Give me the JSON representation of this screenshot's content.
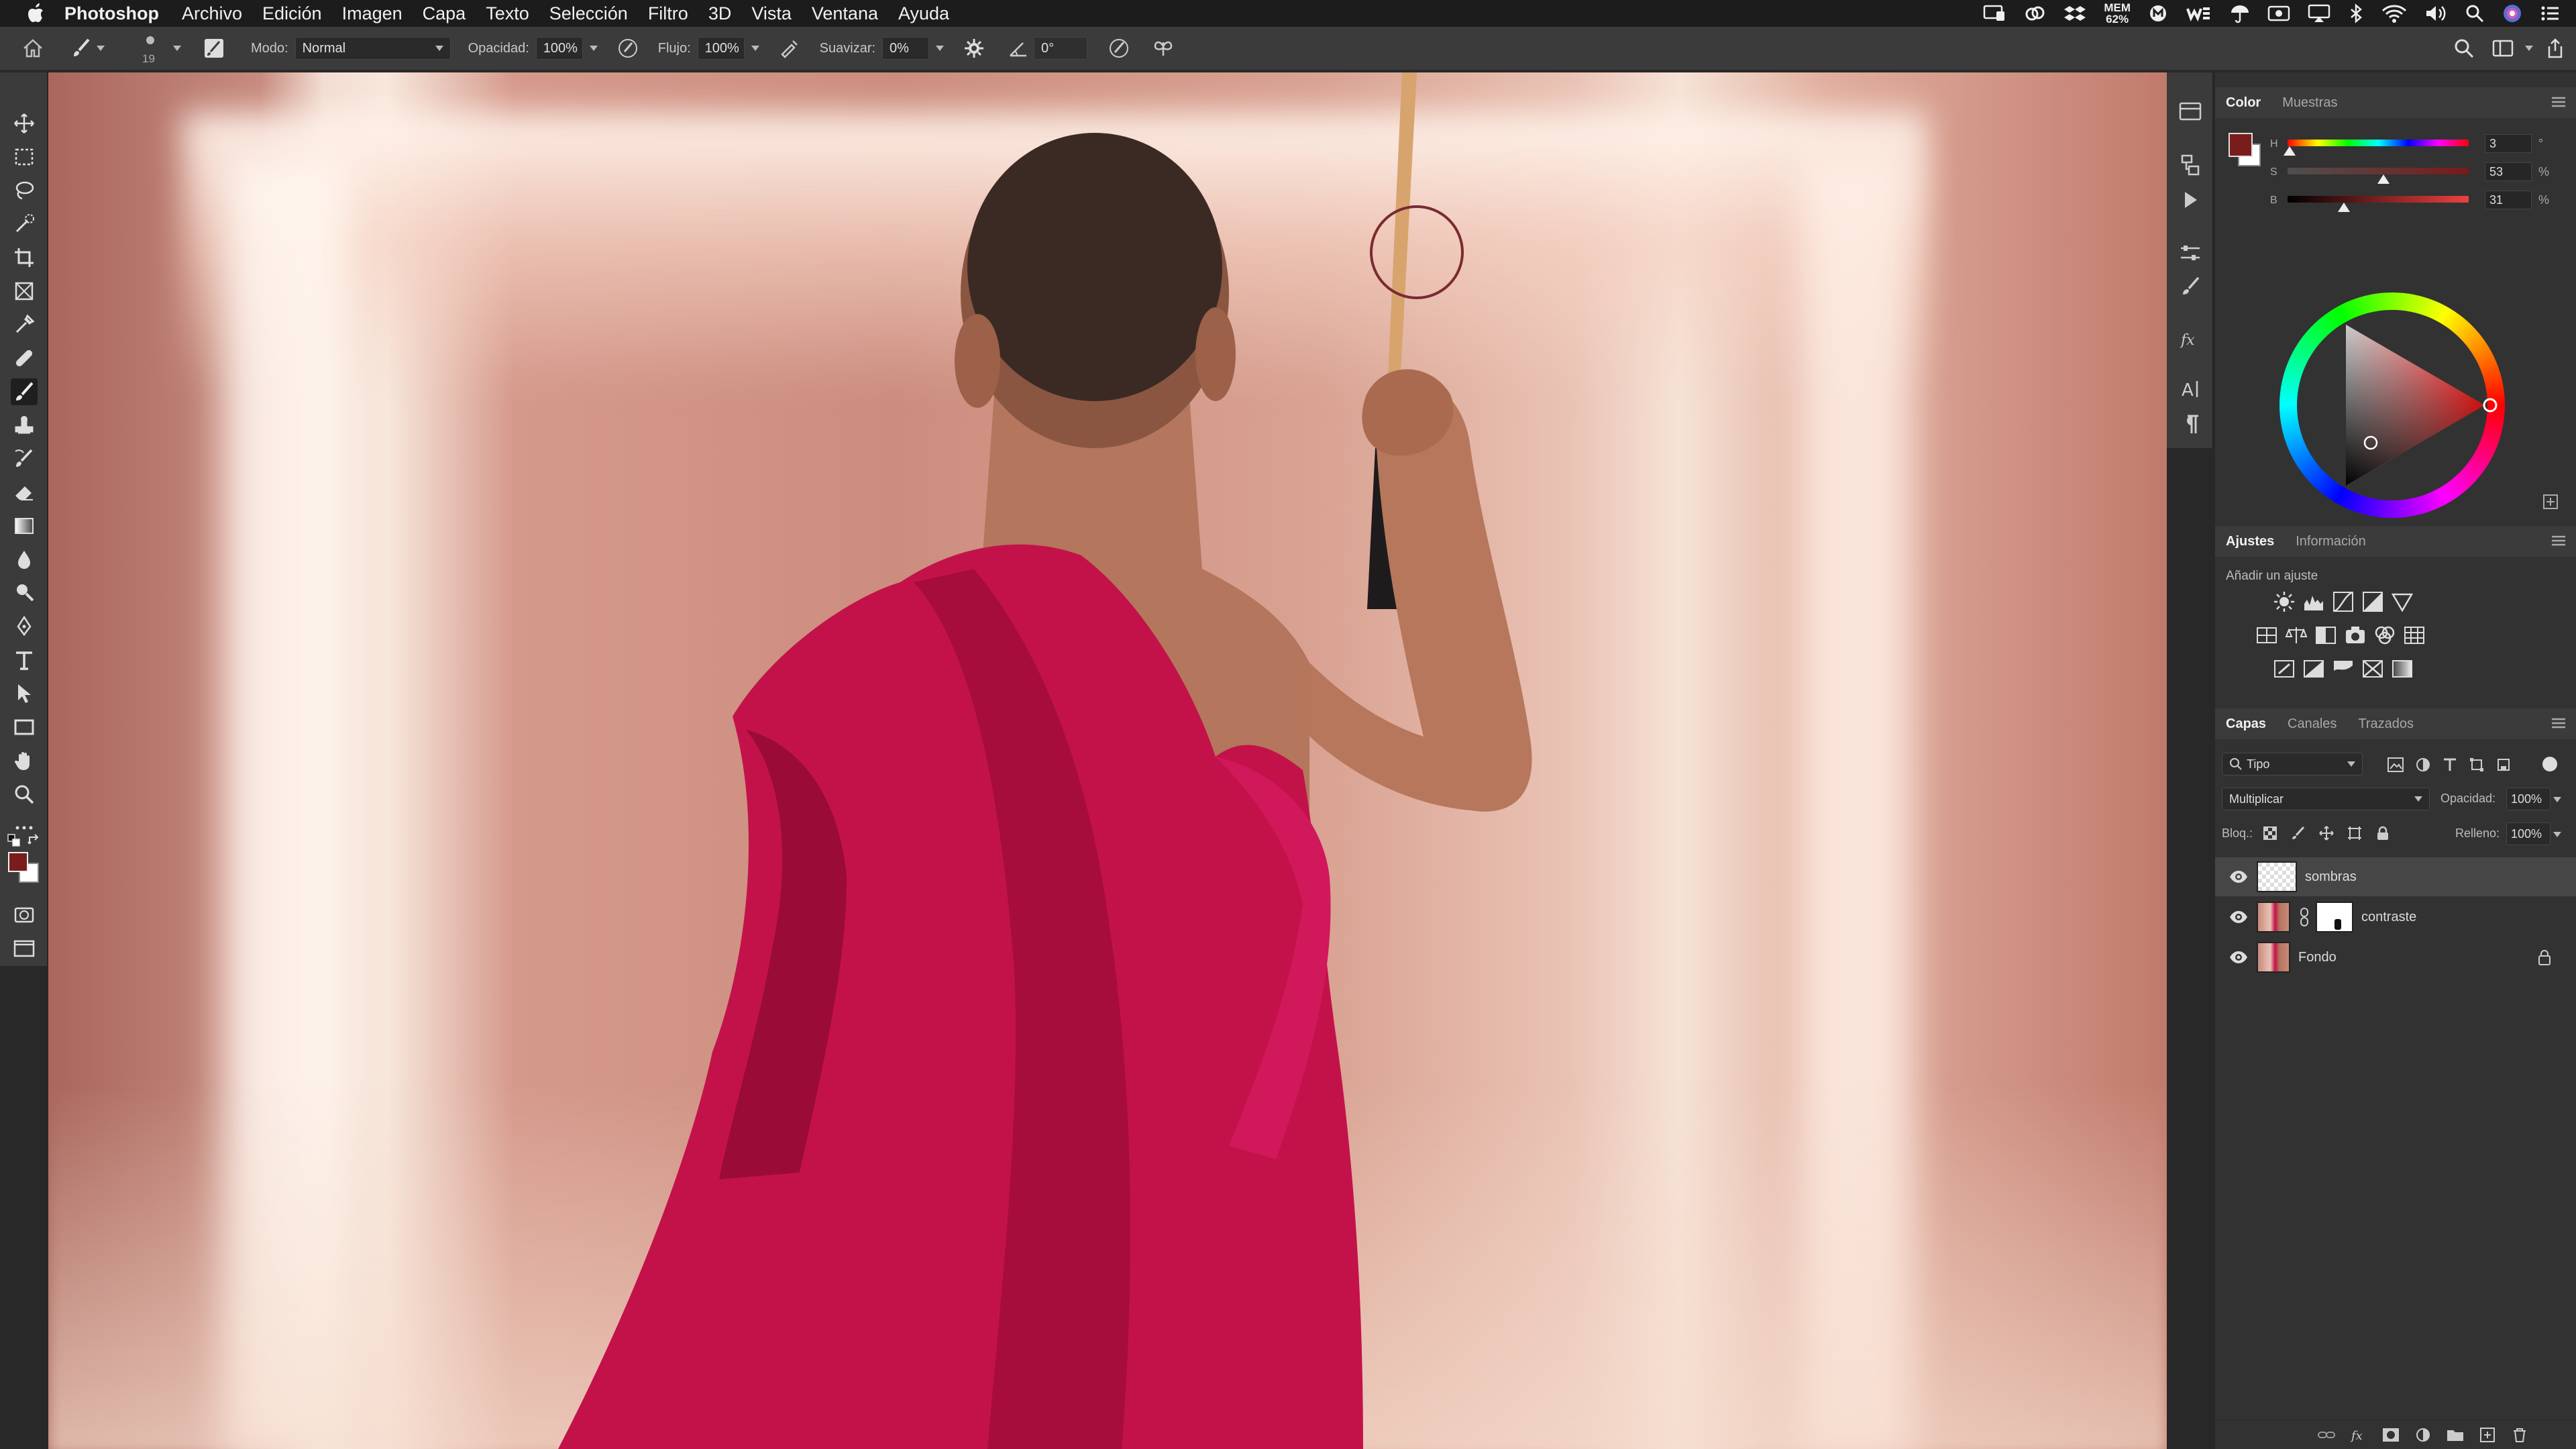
{
  "menubar": {
    "app_name": "Photoshop",
    "items": [
      "Archivo",
      "Edición",
      "Imagen",
      "Capa",
      "Texto",
      "Selección",
      "Filtro",
      "3D",
      "Vista",
      "Ventana",
      "Ayuda"
    ],
    "mem_label": "MEM",
    "mem_value": "62%"
  },
  "options_bar": {
    "brush_size": "19",
    "mode_label": "Modo:",
    "mode_value": "Normal",
    "opacity_label": "Opacidad:",
    "opacity_value": "100%",
    "flow_label": "Flujo:",
    "flow_value": "100%",
    "smoothing_label": "Suavizar:",
    "smoothing_value": "0%",
    "angle_value": "0°"
  },
  "color_panel": {
    "tabs": [
      "Color",
      "Muestras"
    ],
    "active_tab": "Color",
    "foreground_color": "#7a1c1c",
    "background_color": "#ffffff",
    "sliders": [
      {
        "channel": "H",
        "value": "3",
        "unit": "°",
        "fraction": 0.01
      },
      {
        "channel": "S",
        "value": "53",
        "unit": "%",
        "fraction": 0.53
      },
      {
        "channel": "B",
        "value": "31",
        "unit": "%",
        "fraction": 0.31
      }
    ]
  },
  "adjustments_panel": {
    "tabs": [
      "Ajustes",
      "Información"
    ],
    "active_tab": "Ajustes",
    "hint": "Añadir un ajuste",
    "rows": [
      [
        "brightness-icon",
        "levels-icon",
        "curves-icon",
        "exposure-icon",
        "vibrance-icon"
      ],
      [
        "hue-saturation-icon",
        "color-balance-icon",
        "black-white-icon",
        "photo-filter-icon",
        "channel-mixer-icon",
        "color-lookup-icon"
      ],
      [
        "invert-icon",
        "posterize-icon",
        "threshold-icon",
        "selective-color-icon",
        "gradient-map-icon"
      ]
    ]
  },
  "layers_panel": {
    "tabs": [
      "Capas",
      "Canales",
      "Trazados"
    ],
    "active_tab": "Capas",
    "filter_value": "Tipo",
    "blend_mode": "Multiplicar",
    "opacity_label": "Opacidad:",
    "opacity_value": "100%",
    "lock_label": "Bloq.:",
    "fill_label": "Relleno:",
    "fill_value": "100%",
    "layers": [
      {
        "name": "sombras",
        "visible": true,
        "selected": true,
        "has_mask": false,
        "locked": false
      },
      {
        "name": "contraste",
        "visible": true,
        "selected": false,
        "has_mask": true,
        "locked": false
      },
      {
        "name": "Fondo",
        "visible": true,
        "selected": false,
        "has_mask": false,
        "locked": true
      }
    ]
  }
}
